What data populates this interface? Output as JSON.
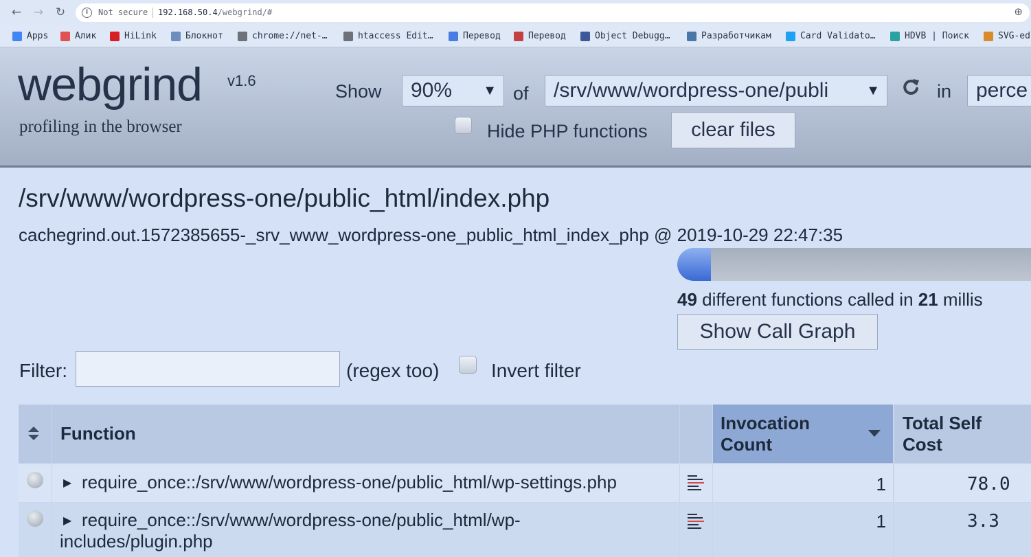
{
  "browser": {
    "not_secure": "Not secure",
    "url_host": "192.168.50.4",
    "url_path": "/webgrind/#",
    "bookmarks": [
      {
        "label": "Apps",
        "icon": "apps-grid-icon",
        "color": "#4285f4"
      },
      {
        "label": "Алик",
        "icon": "bookmark-gift-icon",
        "color": "#e05252"
      },
      {
        "label": "HiLink",
        "icon": "huawei-icon",
        "color": "#d81f26"
      },
      {
        "label": "Блокнот",
        "icon": "notepad-icon",
        "color": "#6c8ebf"
      },
      {
        "label": "chrome://net-…",
        "icon": "globe-icon",
        "color": "#6d7278"
      },
      {
        "label": "htaccess Edit…",
        "icon": "globe-icon",
        "color": "#6d7278"
      },
      {
        "label": "Перевод",
        "icon": "translate-icon",
        "color": "#4a7de3"
      },
      {
        "label": "Перевод",
        "icon": "translate-a-icon",
        "color": "#c44040"
      },
      {
        "label": "Object Debugg…",
        "icon": "facebook-icon",
        "color": "#3b5998"
      },
      {
        "label": "Разработчикам",
        "icon": "vk-icon",
        "color": "#4a76a8"
      },
      {
        "label": "Card Validato…",
        "icon": "twitter-icon",
        "color": "#1da1f2"
      },
      {
        "label": "HDVB | Поиск",
        "icon": "hdvb-icon",
        "color": "#2aa3a0"
      },
      {
        "label": "SVG-ed",
        "icon": "svg-editor-icon",
        "color": "#d98a2b"
      }
    ]
  },
  "header": {
    "logo": "webgrind",
    "version": "v1.6",
    "tagline": "profiling in the browser",
    "show_label": "Show",
    "percent_value": "90%",
    "of_label": "of",
    "file_value": "/srv/www/wordpress-one/publi",
    "in_label": "in",
    "unit_value": "perce",
    "hide_php_label": "Hide PHP functions",
    "hide_php_checked": false,
    "clear_files_label": "clear files"
  },
  "main": {
    "title": "/srv/www/wordpress-one/public_html/index.php",
    "subtitle": "cachegrind.out.1572385655-_srv_www_wordpress-one_public_html_index_php @ 2019-10-29 22:47:35",
    "progress_fraction": 0.095,
    "summary_count": "49",
    "summary_mid": " different functions called in ",
    "summary_time": "21",
    "summary_tail": " millis",
    "call_graph_label": "Show Call Graph",
    "filter_label": "Filter:",
    "filter_value": "",
    "regex_hint": "(regex too)",
    "invert_label": "Invert filter",
    "invert_checked": false
  },
  "table": {
    "columns": {
      "function": "Function",
      "invocation_line1": "Invocation",
      "invocation_line2": "Count",
      "selfcost_line1": "Total Self",
      "selfcost_line2": "Cost"
    },
    "rows": [
      {
        "name_line1": "require_once::/srv/www/wordpress-one/public_html/wp-settings.php",
        "name_line2": "",
        "invocations": "1",
        "self_cost": "78.0"
      },
      {
        "name_line1": "require_once::/srv/www/wordpress-one/public_html/wp-",
        "name_line2": "includes/plugin.php",
        "invocations": "1",
        "self_cost": "3.3"
      }
    ]
  }
}
